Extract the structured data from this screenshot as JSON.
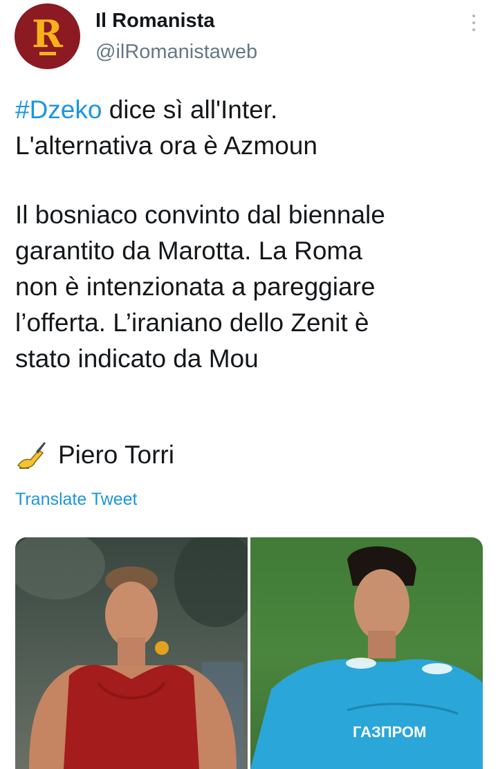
{
  "tweet": {
    "account_name": "Il Romanista",
    "handle": "@ilRomanistaweb",
    "avatar_letter": "R",
    "hashtag": "#Dzeko",
    "line1_rest": " dice sì all'Inter.",
    "line2": "L'alternativa ora è Azmoun",
    "body_lines": [
      "Il bosniaco convinto dal biennale",
      "garantito da Marotta. La Roma",
      "non è intenzionata a pareggiare",
      "l’offerta. L’iraniano dello Zenit è",
      "stato indicato da Mou"
    ],
    "signature": "Piero Torri",
    "signature_icon": "writing-hand-icon",
    "translate_label": "Translate Tweet",
    "more_icon": "more-vertical-icon"
  },
  "media": {
    "left_photo": "Player in red training shirt",
    "right_photo": "Player in light blue Zenit shirt",
    "right_sponsor": "ГАЗПРОМ"
  },
  "colors": {
    "link": "#1b95e0",
    "secondary_text": "#657786",
    "avatar_bg": "#8b1a22",
    "avatar_fg": "#f6b21a"
  }
}
